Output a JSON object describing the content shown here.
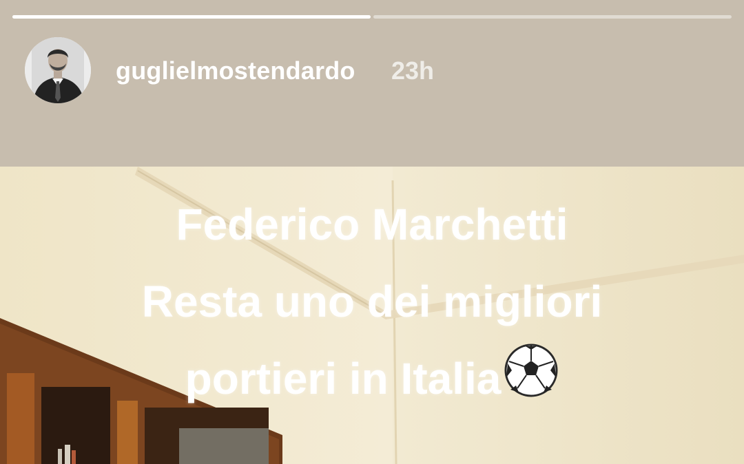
{
  "story": {
    "progress": {
      "segments": 2,
      "current_segment": 1,
      "current_fill_fraction": 1.0
    },
    "user": {
      "username": "guglielmostendardo",
      "time_ago": "23h",
      "avatar_icon": "profile-photo"
    },
    "caption": {
      "line1": "Federico Marchetti",
      "line2": "Resta uno dei migliori",
      "line3": "portieri in Italia",
      "emoji_icon": "soccer-ball-icon"
    },
    "colors": {
      "header_bg": "#c7bdae",
      "text": "#ffffff"
    }
  }
}
